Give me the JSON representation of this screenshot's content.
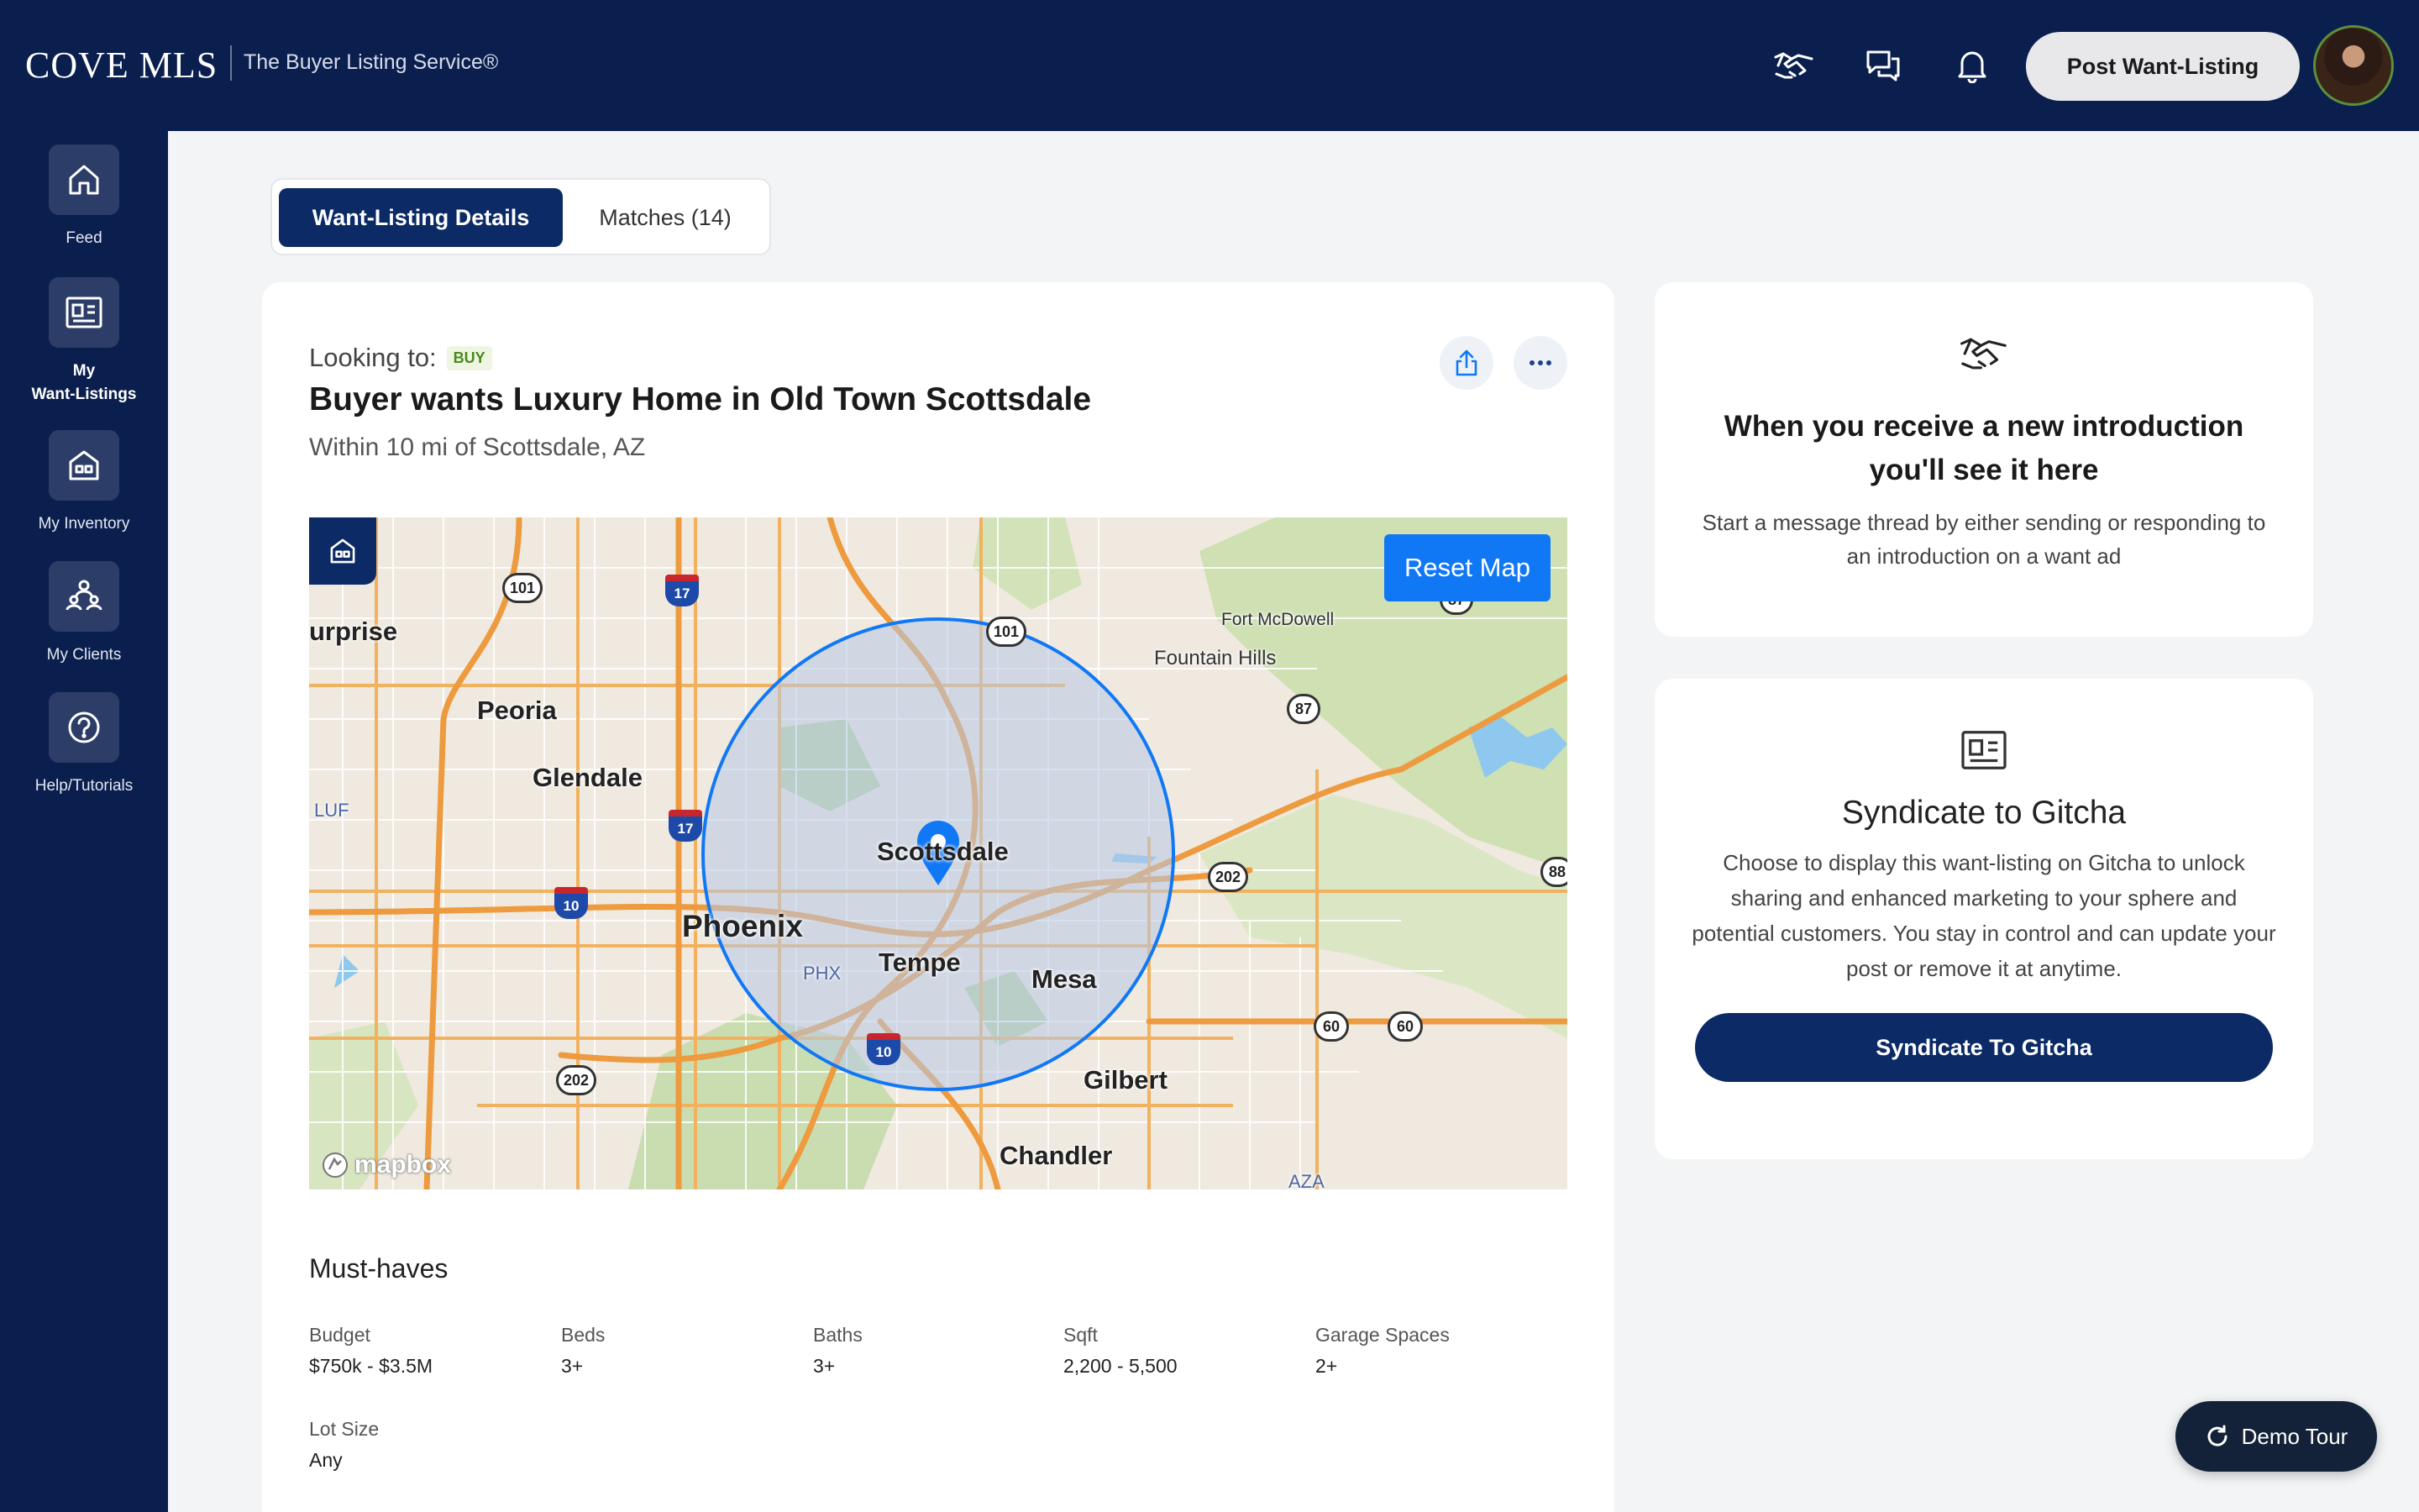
{
  "brand": {
    "logo": "COVE MLS",
    "tagline": "The Buyer Listing Service®"
  },
  "header": {
    "post_button": "Post Want-Listing"
  },
  "sidebar": {
    "items": [
      {
        "label": "Feed",
        "icon": "home-icon"
      },
      {
        "label": "My\nWant-Listings",
        "icon": "listing-icon",
        "active": true
      },
      {
        "label": "My Inventory",
        "icon": "house-icon"
      },
      {
        "label": "My Clients",
        "icon": "clients-icon"
      },
      {
        "label": "Help/Tutorials",
        "icon": "help-icon"
      }
    ]
  },
  "tabs": [
    {
      "label": "Want-Listing Details",
      "active": true
    },
    {
      "label": "Matches (14)",
      "active": false
    }
  ],
  "listing": {
    "looking_to_label": "Looking to:",
    "looking_to_value": "BUY",
    "title": "Buyer wants Luxury Home in Old Town Scottsdale",
    "subtitle": "Within 10 mi of Scottsdale, AZ"
  },
  "map": {
    "reset_label": "Reset Map",
    "attribution": "mapbox",
    "places": {
      "surprise": "urprise",
      "peoria": "Peoria",
      "glendale": "Glendale",
      "phoenix": "Phoenix",
      "scottsdale": "Scottsdale",
      "tempe": "Tempe",
      "mesa": "Mesa",
      "gilbert": "Gilbert",
      "chandler": "Chandler",
      "fountain_hills": "Fountain Hills",
      "fort_mcdowell": "Fort McDowell",
      "luf": "LUF",
      "phx": "PHX",
      "aza": "AZA"
    },
    "routes": {
      "r101a": "101",
      "r101b": "101",
      "r17a": "17",
      "r17b": "17",
      "r10a": "10",
      "r10b": "10",
      "r87": "87",
      "r202a": "202",
      "r202b": "202",
      "r60a": "60",
      "r60b": "60",
      "r88": "88",
      "r87b": "87"
    }
  },
  "must_haves": {
    "title": "Must-haves",
    "items": [
      {
        "label": "Budget",
        "value": "$750k - $3.5M"
      },
      {
        "label": "Beds",
        "value": "3+"
      },
      {
        "label": "Baths",
        "value": "3+"
      },
      {
        "label": "Sqft",
        "value": "2,200 - 5,500"
      },
      {
        "label": "Garage Spaces",
        "value": "2+"
      },
      {
        "label": "Lot Size",
        "value": "Any"
      }
    ]
  },
  "intro_card": {
    "heading": "When you receive a new introduction you'll see it here",
    "body": "Start a message thread by either sending or responding to an introduction on a want ad"
  },
  "syndicate_card": {
    "heading": "Syndicate to Gitcha",
    "body": "Choose to display this want-listing on Gitcha to unlock sharing and enhanced marketing to your sphere and potential customers. You stay in control and can update your post or remove it at anytime.",
    "button": "Syndicate To Gitcha"
  },
  "demo_tour": {
    "label": "Demo Tour"
  },
  "colors": {
    "navy": "#0b1f4f",
    "accent_blue": "#1178f5",
    "buy_green": "#4a8a1c"
  }
}
